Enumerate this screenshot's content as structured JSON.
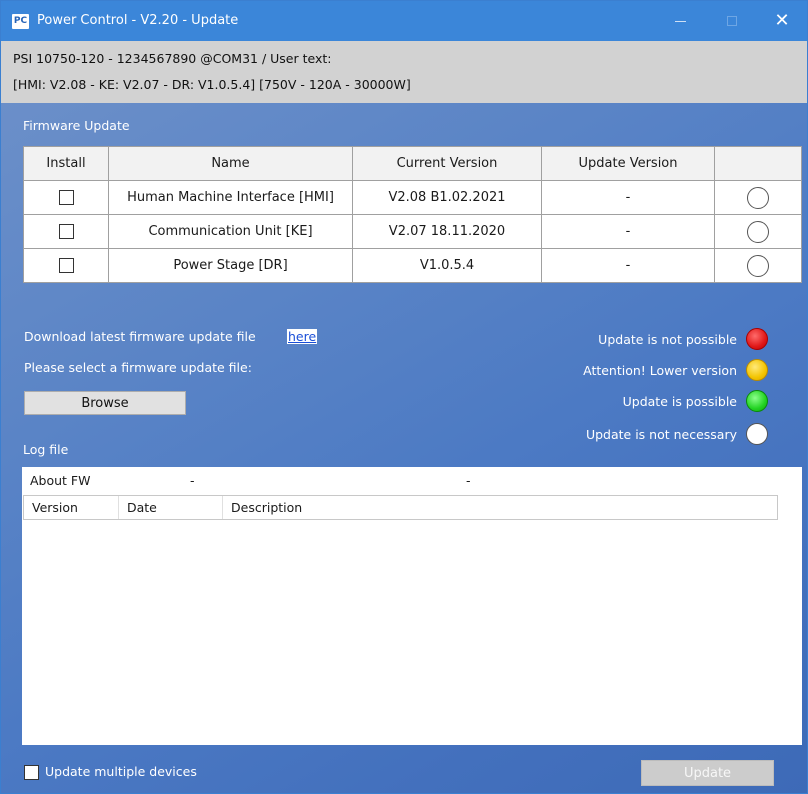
{
  "titlebar": {
    "app_icon": "PC",
    "title": "Power Control - V2.20 - Update",
    "minimize_icon": "minimize-icon",
    "maximize_icon": "maximize-icon",
    "close_glyph": "✕"
  },
  "info": {
    "line1": "PSI 10750-120 - 1234567890 @COM31 / User text:",
    "line2": "[HMI: V2.08 - KE: V2.07 - DR: V1.0.5.4] [750V - 120A - 30000W]"
  },
  "firmware": {
    "section_label": "Firmware Update",
    "columns": [
      "Install",
      "Name",
      "Current Version",
      "Update Version",
      ""
    ],
    "rows": [
      {
        "name": "Human Machine Interface [HMI]",
        "current": "V2.08 B1.02.2021",
        "update": "-"
      },
      {
        "name": "Communication Unit [KE]",
        "current": "V2.07 18.11.2020",
        "update": "-"
      },
      {
        "name": "Power Stage [DR]",
        "current": "V1.0.5.4",
        "update": "-"
      }
    ]
  },
  "download": {
    "text": "Download latest firmware update file",
    "link": "here",
    "select_text": "Please select a firmware update file:",
    "browse": "Browse"
  },
  "legend": {
    "not_possible": "Update is not possible",
    "lower_version": "Attention! Lower version",
    "possible": "Update is possible",
    "not_necessary": "Update is not necessary",
    "colors": {
      "red": "#e01818",
      "yellow": "#f3c400",
      "green": "#22d322",
      "white": "#ffffff"
    }
  },
  "log": {
    "label": "Log file",
    "about": "About FW",
    "about_dash1": "-",
    "about_dash2": "-",
    "columns": [
      "Version",
      "Date",
      "Description"
    ]
  },
  "bottom": {
    "multi_label": "Update multiple devices",
    "update_button": "Update"
  }
}
